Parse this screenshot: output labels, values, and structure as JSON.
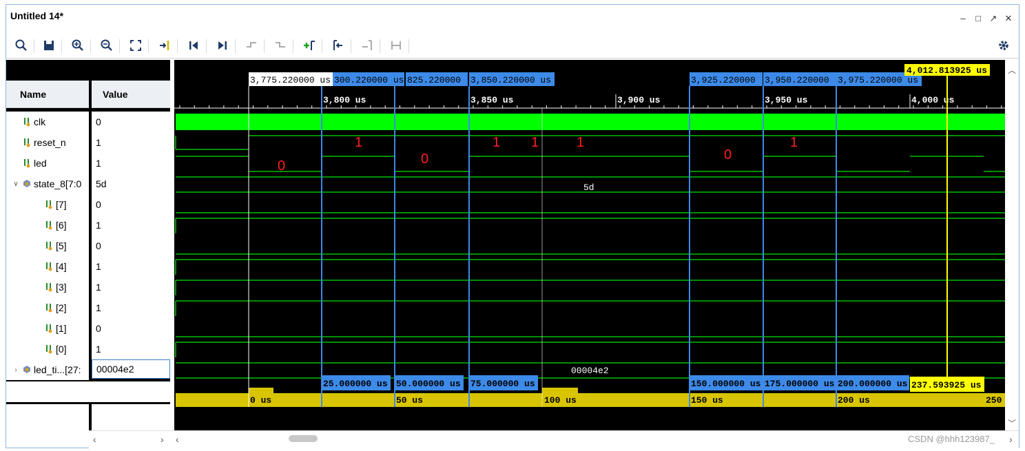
{
  "window": {
    "title": "Untitled 14*"
  },
  "columns": {
    "name": "Name",
    "value": "Value"
  },
  "signals": [
    {
      "name": "clk",
      "value": "0",
      "type": "bit",
      "indent": 0
    },
    {
      "name": "reset_n",
      "value": "1",
      "type": "bit",
      "indent": 0
    },
    {
      "name": "led",
      "value": "1",
      "type": "bit",
      "indent": 0
    },
    {
      "name": "state_8[7:0",
      "value": "5d",
      "type": "bus",
      "indent": 0,
      "expanded": true
    },
    {
      "name": "[7]",
      "value": "0",
      "type": "bit",
      "indent": 1
    },
    {
      "name": "[6]",
      "value": "1",
      "type": "bit",
      "indent": 1
    },
    {
      "name": "[5]",
      "value": "0",
      "type": "bit",
      "indent": 1
    },
    {
      "name": "[4]",
      "value": "1",
      "type": "bit",
      "indent": 1
    },
    {
      "name": "[3]",
      "value": "1",
      "type": "bit",
      "indent": 1
    },
    {
      "name": "[2]",
      "value": "1",
      "type": "bit",
      "indent": 1
    },
    {
      "name": "[1]",
      "value": "0",
      "type": "bit",
      "indent": 1
    },
    {
      "name": "[0]",
      "value": "1",
      "type": "bit",
      "indent": 1
    },
    {
      "name": "led_ti...[27:",
      "value": "00004e2",
      "type": "bus",
      "indent": 0,
      "expanded": false
    }
  ],
  "timeline": {
    "ruler_ticks": [
      "3,800 us",
      "3,850 us",
      "3,900 us",
      "3,950 us",
      "4,000 us"
    ],
    "top_markers": [
      "3,775.220000 us",
      "300.220000 us",
      "825.220000",
      "3,850.220000 us",
      "3,925.220000",
      "3,950.220000",
      "3,975.220000 us"
    ],
    "cursor_top": "4,012.813925 us",
    "bottom_markers": [
      "25.000000 us",
      "50.000000 us",
      "75.000000 us",
      "150.000000 us",
      "175.000000 us",
      "200.000000 us"
    ],
    "cursor_bottom": "237.593925 us",
    "bottom_ruler": [
      "0 us",
      "50 us",
      "100 us",
      "150 us",
      "200 us",
      "250"
    ],
    "bus_values": {
      "state": "5d",
      "led_timer": "00004e2"
    },
    "annotations": [
      "0",
      "1",
      "0",
      "1",
      "1",
      "1",
      "0",
      "1"
    ]
  },
  "watermark": "CSDN @hhh123987_",
  "colors": {
    "clk": "#00ff00",
    "wave": "#00c000",
    "marker": "#3d8ae8",
    "cursor": "#ffff00",
    "ruler_bottom": "#d8c400",
    "annotation": "#ff2020"
  }
}
